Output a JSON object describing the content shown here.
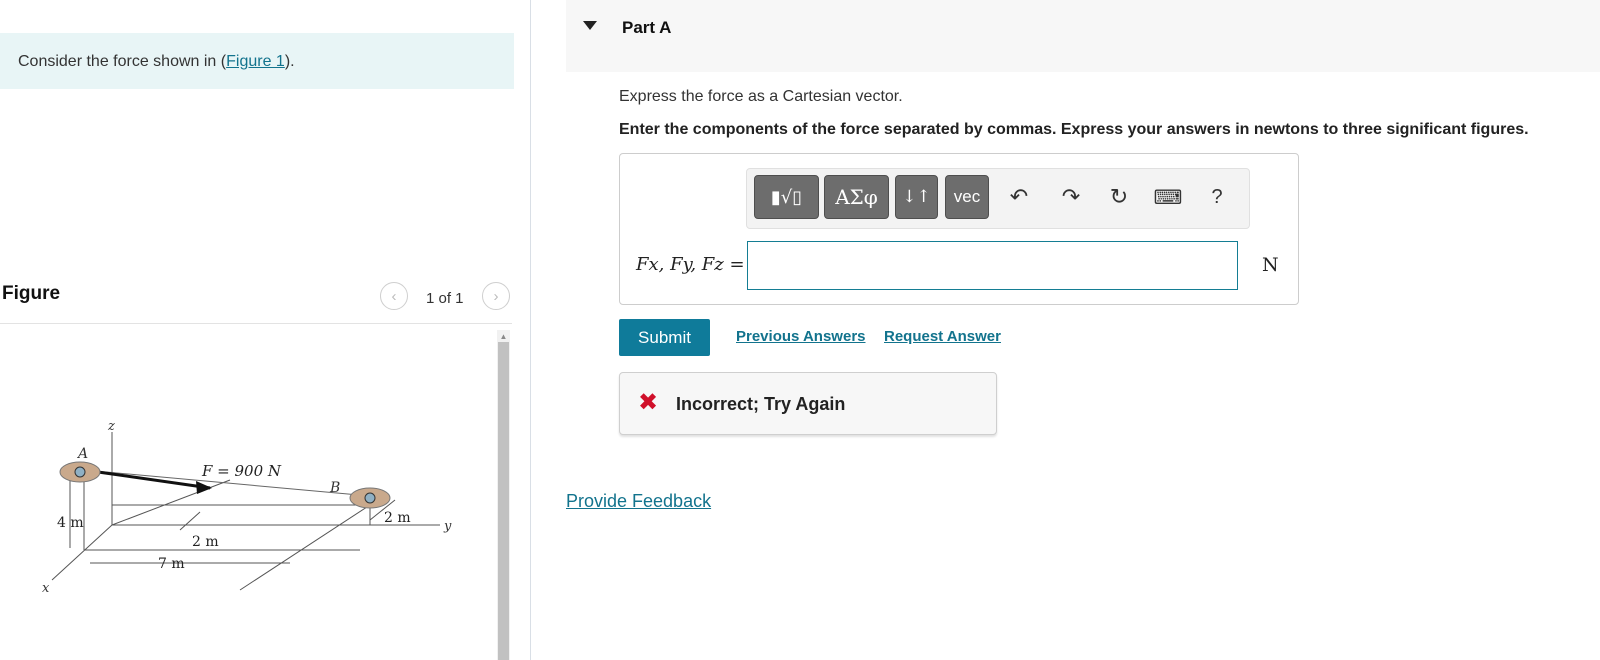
{
  "problem": {
    "text_before": "Consider the force shown in (",
    "link": "Figure 1",
    "text_after": ")."
  },
  "figure_panel": {
    "title": "Figure",
    "counter": "1 of 1",
    "prev_icon": "chevron-left-icon",
    "next_icon": "chevron-right-icon"
  },
  "figure_labels": {
    "axis_z": "z",
    "axis_x": "x",
    "axis_y": "y",
    "point_a": "A",
    "point_b": "B",
    "force": "F = 900 N",
    "dim_4m": "4 m",
    "dim_7m": "7 m",
    "dim_2m_x": "2 m",
    "dim_2m_y": "2 m"
  },
  "part_a": {
    "title": "Part A",
    "prompt": "Express the force as a Cartesian vector.",
    "instructions": "Enter the components of the force separated by commas. Express your answers in newtons to three significant figures."
  },
  "toolbar": {
    "templates_label": "▮√▯",
    "greek_label": "ΑΣφ",
    "arrows_label": "↓↑",
    "vec_label": "vec",
    "undo_icon": "undo-icon",
    "redo_icon": "redo-icon",
    "reset_icon": "reset-icon",
    "keyboard_icon": "keyboard-icon",
    "help_label": "?"
  },
  "answer": {
    "label": "Fx, Fy, Fz =",
    "value": "",
    "unit": "N"
  },
  "actions": {
    "submit": "Submit",
    "previous_answers": "Previous Answers",
    "request_answer": "Request Answer"
  },
  "feedback": {
    "message": "Incorrect; Try Again",
    "icon": "x-icon",
    "color": "#d0102a"
  },
  "provide_feedback": "Provide Feedback",
  "colors": {
    "accent": "#0f7b9a",
    "link": "#12738d",
    "problem_bg": "#e8f5f6"
  }
}
